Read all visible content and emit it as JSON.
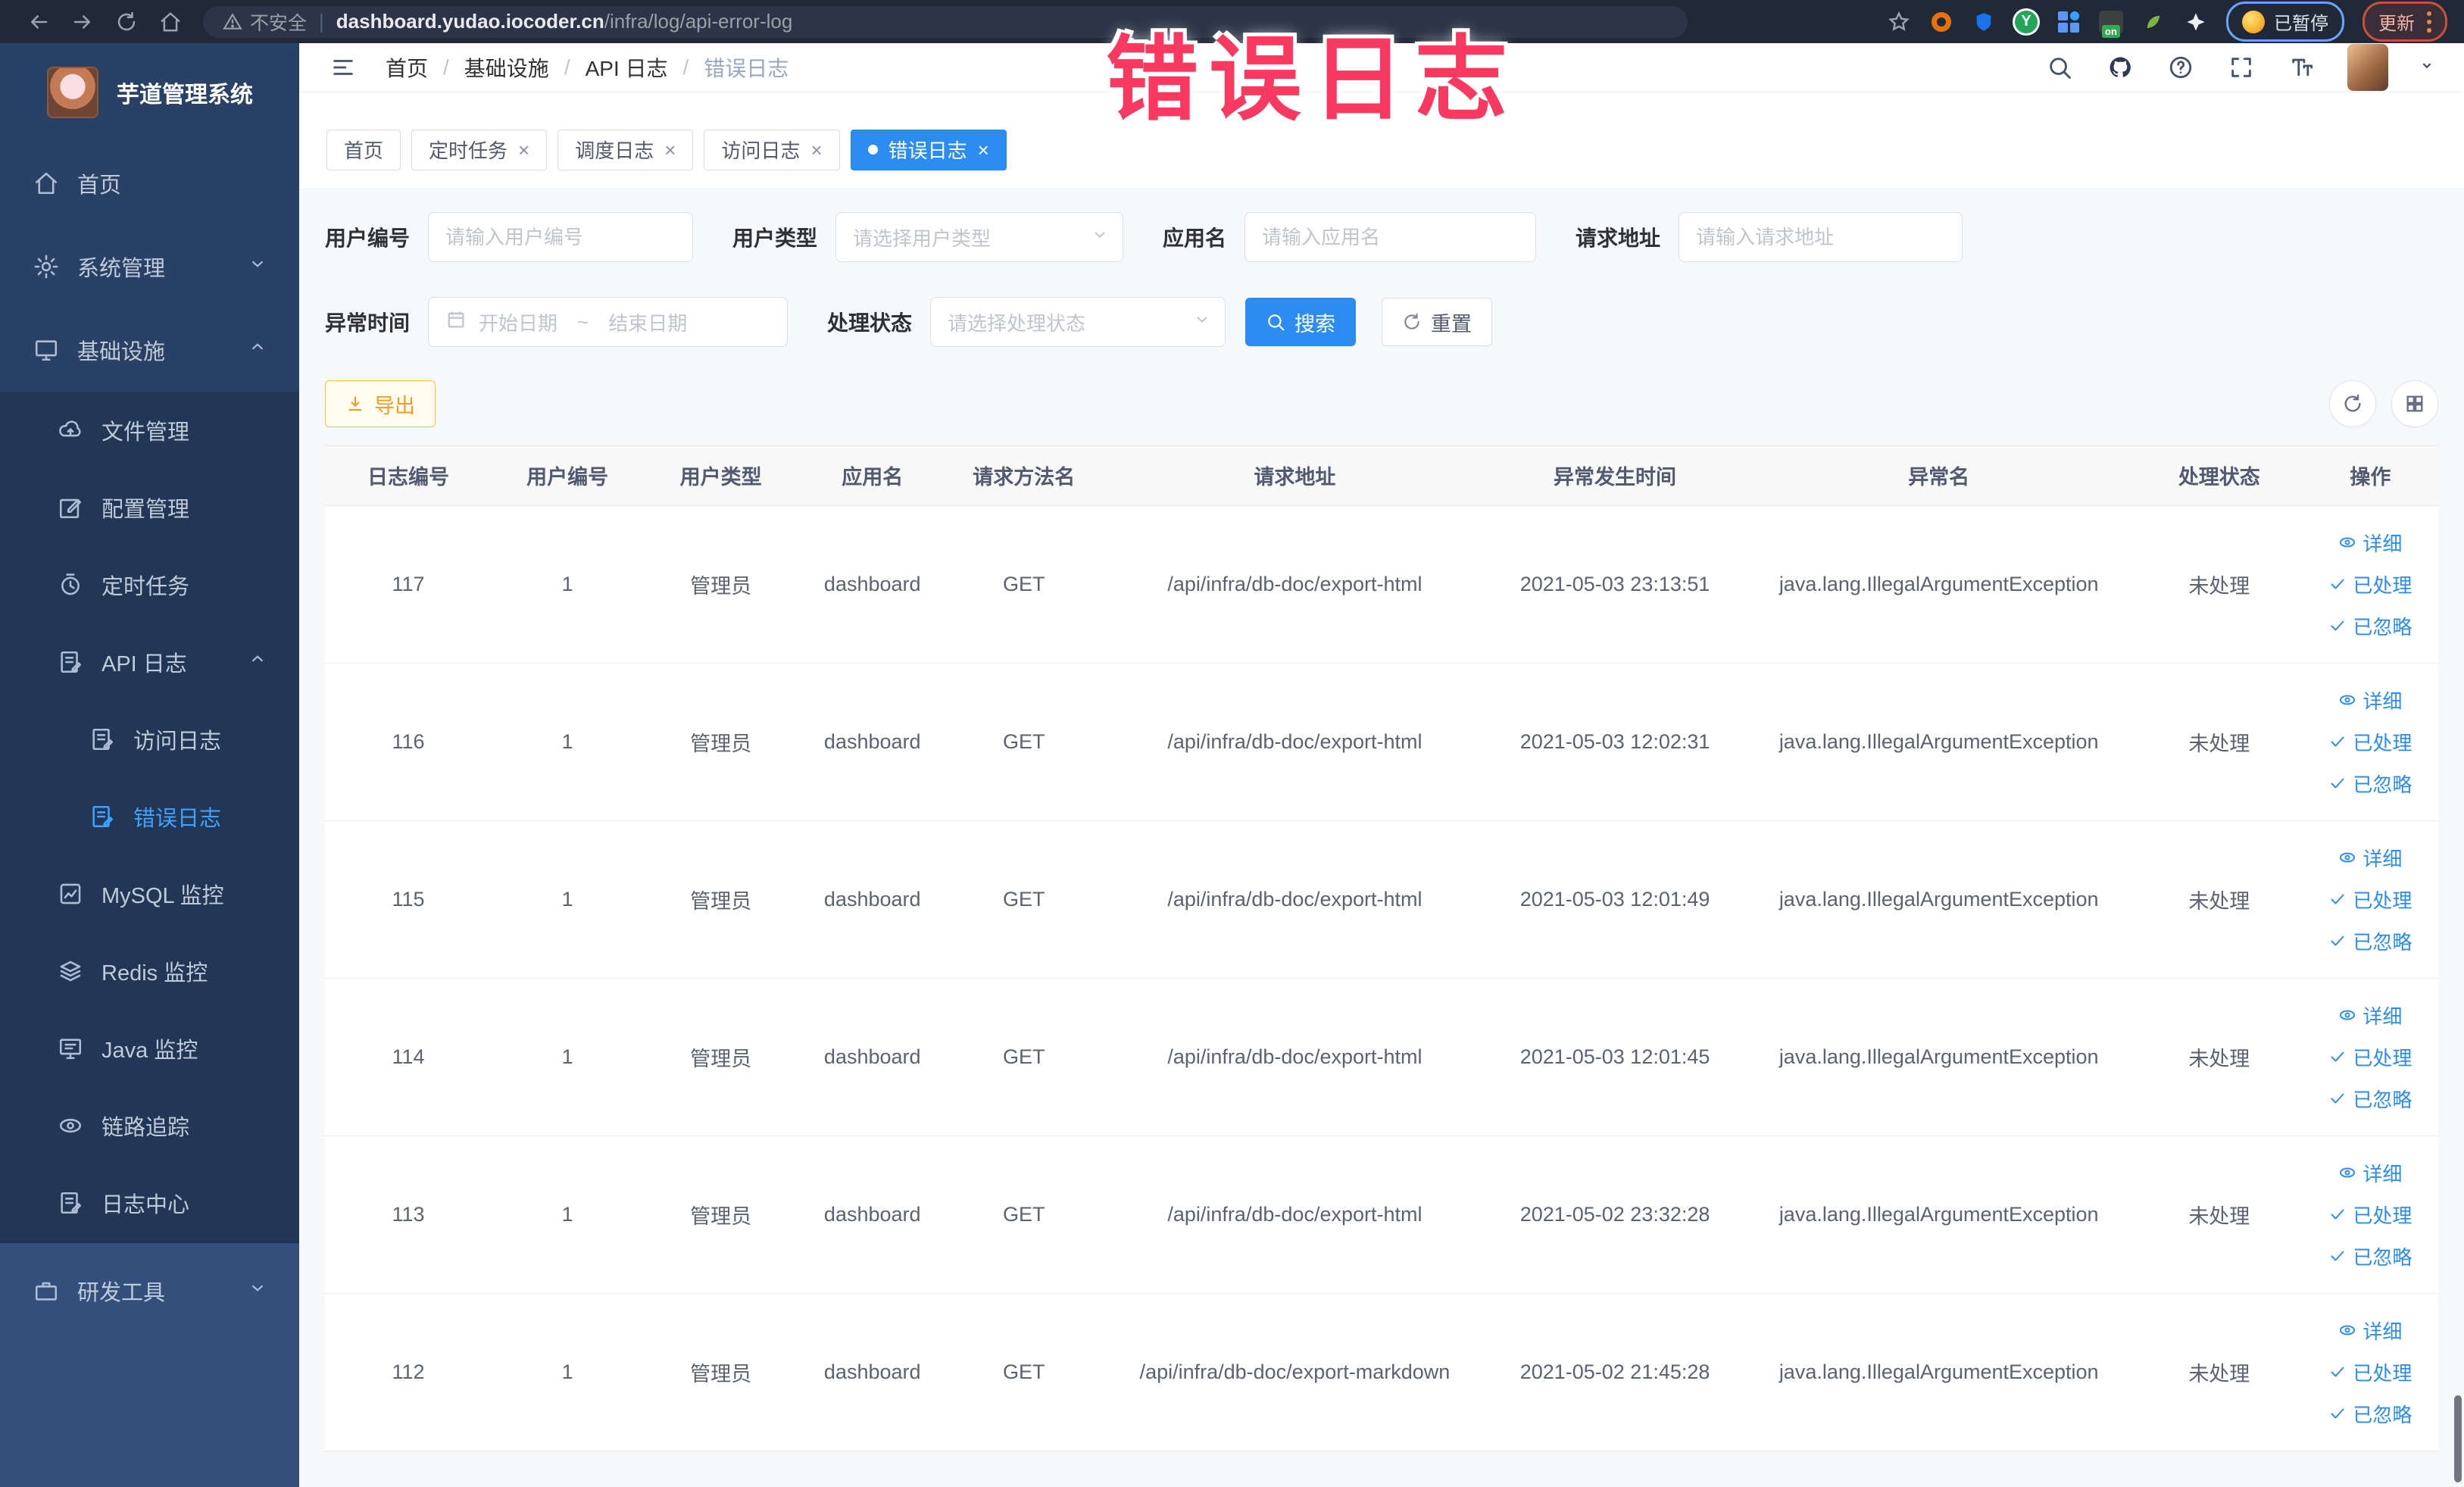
{
  "browser": {
    "security_label": "不安全",
    "url_host": "dashboard.yudao.iocoder.cn",
    "url_path": "/infra/log/api-error-log",
    "paused_badge_label": "已暂停",
    "update_button_label": "更新"
  },
  "annotation": {
    "text": "错误日志"
  },
  "sidebar": {
    "app_title": "芋道管理系统",
    "items": {
      "home": "首页",
      "system": "系统管理",
      "infra": "基础设施",
      "file": "文件管理",
      "config": "配置管理",
      "job": "定时任务",
      "api_log": "API 日志",
      "access_log": "访问日志",
      "error_log": "错误日志",
      "mysql": "MySQL 监控",
      "redis": "Redis 监控",
      "java": "Java 监控",
      "trace": "链路追踪",
      "log_center": "日志中心",
      "dev_tools": "研发工具"
    }
  },
  "navbar": {
    "breadcrumb": [
      "首页",
      "基础设施",
      "API 日志",
      "错误日志"
    ]
  },
  "tabs": [
    {
      "label": "首页"
    },
    {
      "label": "定时任务"
    },
    {
      "label": "调度日志"
    },
    {
      "label": "访问日志"
    },
    {
      "label": "错误日志"
    }
  ],
  "filters": {
    "user_id_label": "用户编号",
    "user_id_placeholder": "请输入用户编号",
    "user_type_label": "用户类型",
    "user_type_placeholder": "请选择用户类型",
    "app_name_label": "应用名",
    "app_name_placeholder": "请输入应用名",
    "request_url_label": "请求地址",
    "request_url_placeholder": "请输入请求地址",
    "exception_time_label": "异常时间",
    "date_start_placeholder": "开始日期",
    "date_separator": "~",
    "date_end_placeholder": "结束日期",
    "process_status_label": "处理状态",
    "process_status_placeholder": "请选择处理状态",
    "search_label": "搜索",
    "reset_label": "重置"
  },
  "toolbar": {
    "export_label": "导出"
  },
  "table": {
    "columns": [
      "日志编号",
      "用户编号",
      "用户类型",
      "应用名",
      "请求方法名",
      "请求地址",
      "异常发生时间",
      "异常名",
      "处理状态",
      "操作"
    ],
    "action_labels": {
      "detail": "详细",
      "processed": "已处理",
      "ignored": "已忽略"
    },
    "rows": [
      {
        "log_id": "117",
        "user_id": "1",
        "user_type": "管理员",
        "app_name": "dashboard",
        "method": "GET",
        "request_url": "/api/infra/db-doc/export-html",
        "time": "2021-05-03 23:13:51",
        "exception": "java.lang.IllegalArgumentException",
        "status": "未处理"
      },
      {
        "log_id": "116",
        "user_id": "1",
        "user_type": "管理员",
        "app_name": "dashboard",
        "method": "GET",
        "request_url": "/api/infra/db-doc/export-html",
        "time": "2021-05-03 12:02:31",
        "exception": "java.lang.IllegalArgumentException",
        "status": "未处理"
      },
      {
        "log_id": "115",
        "user_id": "1",
        "user_type": "管理员",
        "app_name": "dashboard",
        "method": "GET",
        "request_url": "/api/infra/db-doc/export-html",
        "time": "2021-05-03 12:01:49",
        "exception": "java.lang.IllegalArgumentException",
        "status": "未处理"
      },
      {
        "log_id": "114",
        "user_id": "1",
        "user_type": "管理员",
        "app_name": "dashboard",
        "method": "GET",
        "request_url": "/api/infra/db-doc/export-html",
        "time": "2021-05-03 12:01:45",
        "exception": "java.lang.IllegalArgumentException",
        "status": "未处理"
      },
      {
        "log_id": "113",
        "user_id": "1",
        "user_type": "管理员",
        "app_name": "dashboard",
        "method": "GET",
        "request_url": "/api/infra/db-doc/export-html",
        "time": "2021-05-02 23:32:28",
        "exception": "java.lang.IllegalArgumentException",
        "status": "未处理"
      },
      {
        "log_id": "112",
        "user_id": "1",
        "user_type": "管理员",
        "app_name": "dashboard",
        "method": "GET",
        "request_url": "/api/infra/db-doc/export-markdown",
        "time": "2021-05-02 21:45:28",
        "exception": "java.lang.IllegalArgumentException",
        "status": "未处理"
      }
    ]
  },
  "colors": {
    "primary": "#2d8cf0",
    "annotation": "#f83a60",
    "sidebar_bg": "#2a4166",
    "warning_border": "#ffc53d"
  }
}
